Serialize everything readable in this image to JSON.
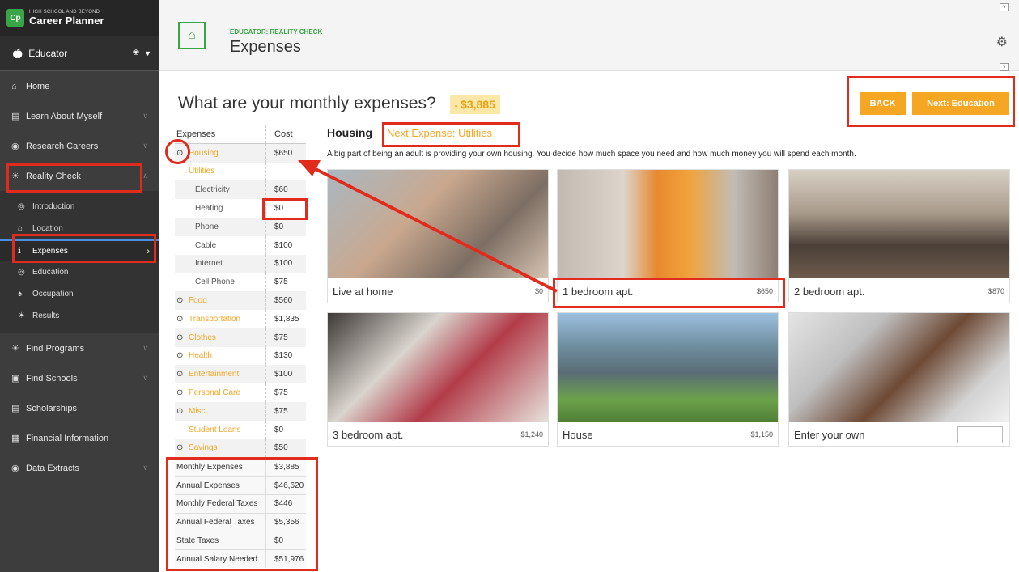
{
  "brand": {
    "logo": "Cp",
    "sub": "HIGH SCHOOL AND BEYOND",
    "title": "Career Planner"
  },
  "role": {
    "label": "Educator",
    "icon": "apple-icon"
  },
  "nav": [
    {
      "label": "Home",
      "icon": "home-icon"
    },
    {
      "label": "Learn About Myself",
      "icon": "book-icon"
    },
    {
      "label": "Research Careers",
      "icon": "search-circle-icon"
    },
    {
      "label": "Reality Check",
      "icon": "sun-icon"
    }
  ],
  "sub_nav": [
    {
      "label": "Introduction"
    },
    {
      "label": "Location"
    },
    {
      "label": "Expenses"
    },
    {
      "label": "Education"
    },
    {
      "label": "Occupation"
    },
    {
      "label": "Results"
    }
  ],
  "nav_lower": [
    {
      "label": "Find Programs"
    },
    {
      "label": "Find Schools"
    },
    {
      "label": "Scholarships"
    },
    {
      "label": "Financial Information"
    },
    {
      "label": "Data Extracts"
    }
  ],
  "header": {
    "subtitle": "EDUCATOR: REALITY CHECK",
    "title": "Expenses"
  },
  "main": {
    "question": "What are your monthly expenses?",
    "total": "$3,885",
    "back_label": "BACK",
    "next_label": "Next: Education"
  },
  "table": {
    "col_expenses": "Expenses",
    "col_cost": "Cost",
    "rows": [
      {
        "label": "Housing",
        "value": "$650"
      },
      {
        "label": "Utilities",
        "value": ""
      },
      {
        "label": "Electricity",
        "value": "$60"
      },
      {
        "label": "Heating",
        "value": "$0"
      },
      {
        "label": "Phone",
        "value": "$0"
      },
      {
        "label": "Cable",
        "value": "$100"
      },
      {
        "label": "Internet",
        "value": "$100"
      },
      {
        "label": "Cell Phone",
        "value": "$75"
      },
      {
        "label": "Food",
        "value": "$560"
      },
      {
        "label": "Transportation",
        "value": "$1,835"
      },
      {
        "label": "Clothes",
        "value": "$75"
      },
      {
        "label": "Health",
        "value": "$130"
      },
      {
        "label": "Entertainment",
        "value": "$100"
      },
      {
        "label": "Personal Care",
        "value": "$75"
      },
      {
        "label": "Misc",
        "value": "$75"
      },
      {
        "label": "Student Loans",
        "value": "$0"
      },
      {
        "label": "Savings",
        "value": "$50"
      }
    ],
    "summary": [
      {
        "label": "Monthly Expenses",
        "value": "$3,885"
      },
      {
        "label": "Annual Expenses",
        "value": "$46,620"
      },
      {
        "label": "Monthly Federal Taxes",
        "value": "$446"
      },
      {
        "label": "Annual Federal Taxes",
        "value": "$5,356"
      },
      {
        "label": "State Taxes",
        "value": "$0"
      },
      {
        "label": "Annual Salary Needed",
        "value": "$51,976"
      }
    ]
  },
  "housing": {
    "title": "Housing",
    "next_expense": "Next Expense: Utilities",
    "description": "A big part of being an adult is providing your own housing. You decide how much space you need and how much money you will spend each month.",
    "options": [
      {
        "label": "Live at home",
        "price": "$0"
      },
      {
        "label": "1 bedroom apt.",
        "price": "$650"
      },
      {
        "label": "2 bedroom apt.",
        "price": "$870"
      },
      {
        "label": "3 bedroom apt.",
        "price": "$1,240"
      },
      {
        "label": "House",
        "price": "$1,150"
      },
      {
        "label": "Enter your own",
        "price": ""
      }
    ]
  },
  "colors": {
    "accent": "#f5a623",
    "brand_green": "#3aa547",
    "annotation_red": "#e02b1d"
  }
}
